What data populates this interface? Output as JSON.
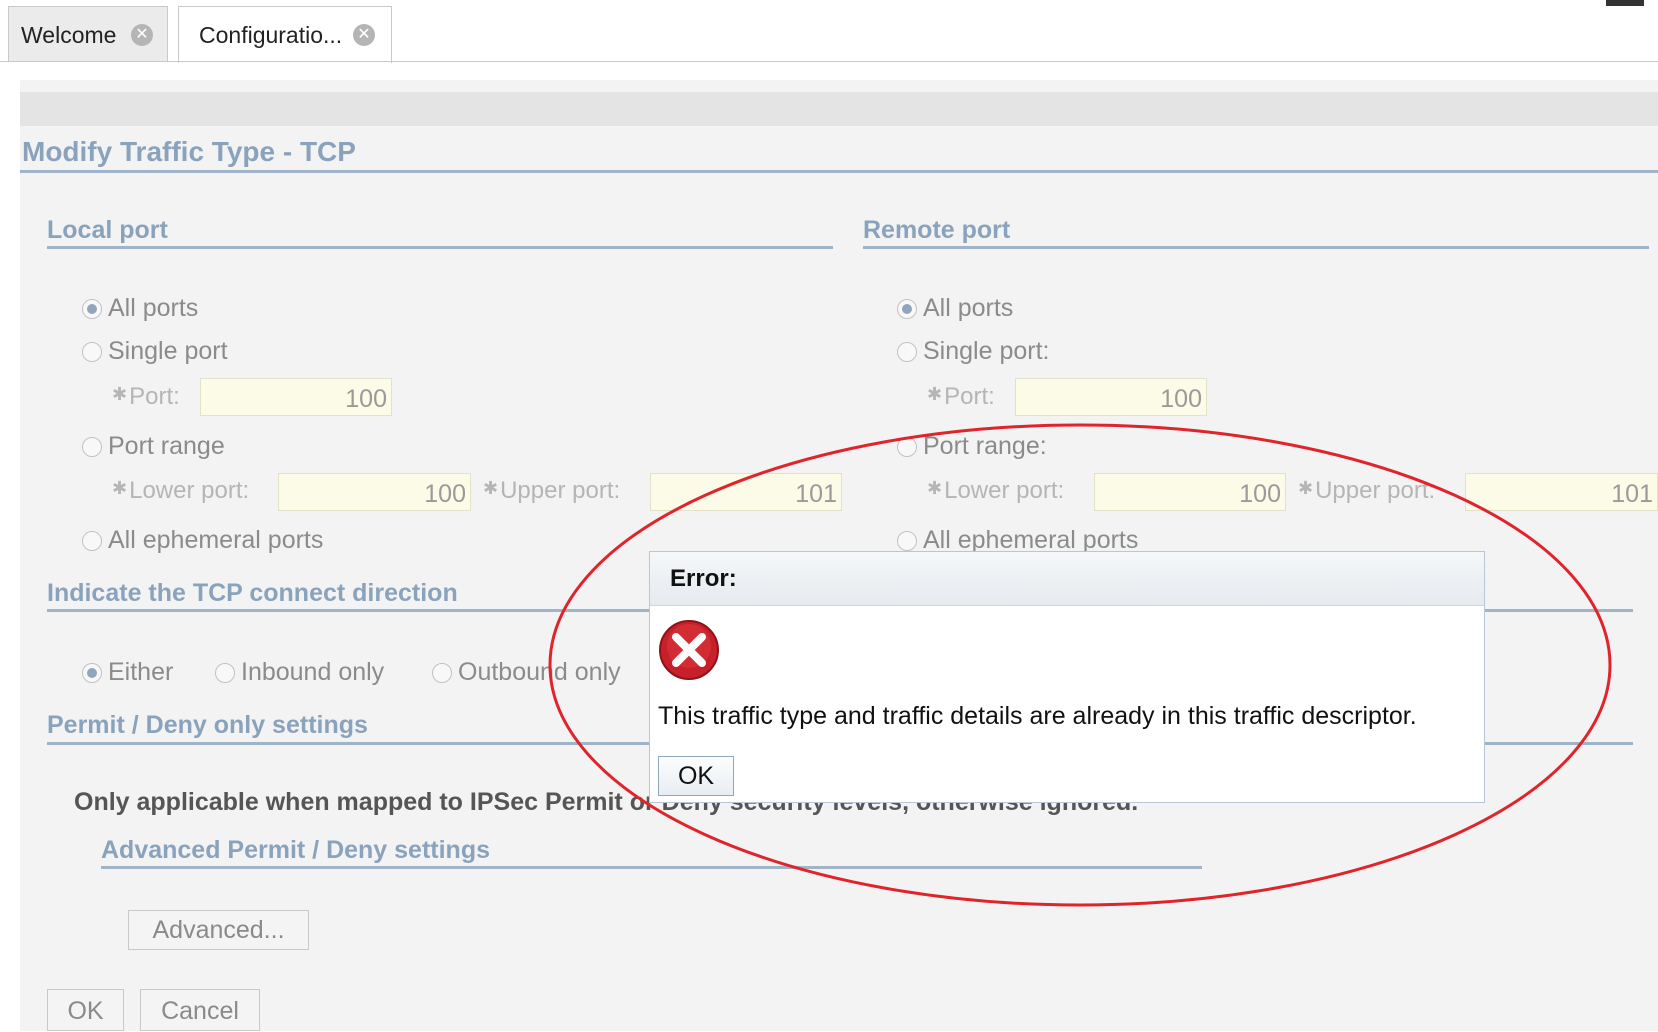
{
  "tabs": [
    {
      "label": "Welcome",
      "close_icon": "close-icon"
    },
    {
      "label": "Configuratio...",
      "close_icon": "close-icon"
    }
  ],
  "page_title": "Modify Traffic Type - TCP",
  "local_port": {
    "heading": "Local port",
    "all_ports": "All ports",
    "single_port": "Single port",
    "port_label": "Port:",
    "port_value": "100",
    "port_range": "Port range",
    "lower_label": "Lower port:",
    "lower_value": "100",
    "upper_label": "Upper port:",
    "upper_value": "101",
    "ephemeral": "All ephemeral ports",
    "selected": "All ports"
  },
  "remote_port": {
    "heading": "Remote port",
    "all_ports": "All ports",
    "single_port": "Single port:",
    "port_label": "Port:",
    "port_value": "100",
    "port_range": "Port range:",
    "lower_label": "Lower port:",
    "lower_value": "100",
    "upper_label": "Upper port:",
    "upper_value": "101",
    "ephemeral": "All ephemeral ports",
    "selected": "All ports"
  },
  "direction": {
    "heading": "Indicate the TCP connect direction",
    "options": [
      "Either",
      "Inbound only",
      "Outbound only"
    ],
    "selected": "Either"
  },
  "permit_deny": {
    "heading": "Permit / Deny only settings",
    "note": "Only applicable when mapped to IPSec Permit or Deny security levels, otherwise ignored.",
    "advanced_heading": "Advanced Permit / Deny settings",
    "advanced_button": "Advanced..."
  },
  "footer": {
    "ok": "OK",
    "cancel": "Cancel"
  },
  "dialog": {
    "title": "Error:",
    "icon": "error-x-icon",
    "message": "This traffic type and traffic details are already in this traffic descriptor.",
    "ok": "OK"
  },
  "colors": {
    "section_heading": "#8aa3bd",
    "annotation": "#e0242b",
    "error_icon": "#c8202a"
  }
}
